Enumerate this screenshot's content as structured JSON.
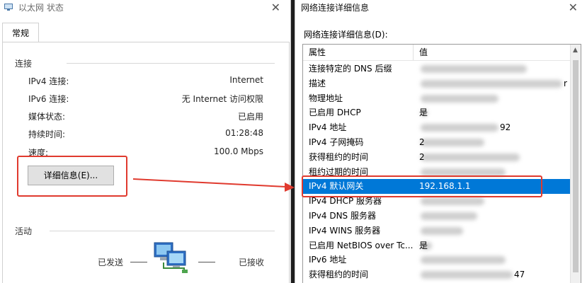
{
  "left_window": {
    "title": "以太网 状态",
    "close_glyph": "✕",
    "tab_general": "常规",
    "connection_group": "连接",
    "rows": [
      {
        "label": "IPv4 连接:",
        "value": "Internet"
      },
      {
        "label": "IPv6 连接:",
        "value": "无 Internet 访问权限"
      },
      {
        "label": "媒体状态:",
        "value": "已启用"
      },
      {
        "label": "持续时间:",
        "value": "01:28:48"
      },
      {
        "label": "速度:",
        "value": "100.0 Mbps"
      }
    ],
    "details_button": "详细信息(E)...",
    "activity_group": "活动",
    "sent_label": "已发送",
    "received_label": "已接收"
  },
  "right_window": {
    "title": "网络连接详细信息",
    "close_glyph": "✕",
    "list_label": "网络连接详细信息(D):",
    "col_property": "属性",
    "col_value": "值",
    "rows": [
      {
        "property": "连接特定的 DNS 后缀",
        "value": ""
      },
      {
        "property": "描述",
        "value": "r"
      },
      {
        "property": "物理地址",
        "value": ""
      },
      {
        "property": "已启用 DHCP",
        "value": "是"
      },
      {
        "property": "IPv4 地址",
        "value": "92"
      },
      {
        "property": "IPv4 子网掩码",
        "value": "2"
      },
      {
        "property": "获得租约的时间",
        "value": "2"
      },
      {
        "property": "租约过期的时间",
        "value": ""
      },
      {
        "property": "IPv4 默认网关",
        "value": "192.168.1.1",
        "selected": true
      },
      {
        "property": "IPv4 DHCP 服务器",
        "value": ""
      },
      {
        "property": "IPv4 DNS 服务器",
        "value": ""
      },
      {
        "property": "IPv4 WINS 服务器",
        "value": ""
      },
      {
        "property": "已启用 NetBIOS over Tc...",
        "value": "是"
      },
      {
        "property": "IPv6 地址",
        "value": ""
      },
      {
        "property": "获得租约的时间",
        "value": "47"
      }
    ]
  },
  "colors": {
    "selection": "#0078d7",
    "highlight_red": "#e03a2e"
  }
}
